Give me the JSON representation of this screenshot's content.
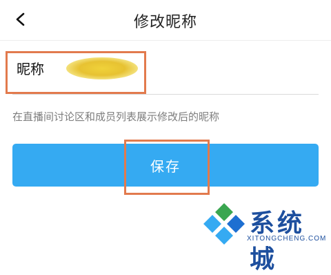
{
  "header": {
    "title": "修改昵称",
    "back_icon": "chevron-left-icon"
  },
  "form": {
    "name_label": "昵称",
    "hint": "在直播间讨论区和成员列表展示修改后的昵称",
    "save_label": "保存"
  },
  "watermark": {
    "brand": "系统城",
    "domain": "XITONGCHENG.COM"
  },
  "colors": {
    "accent": "#35aaf2",
    "highlight": "#e27a4d",
    "hint_text": "#7d7d7d",
    "watermark_blue": "#1d4f9e",
    "watermark_green": "#3aa650"
  }
}
